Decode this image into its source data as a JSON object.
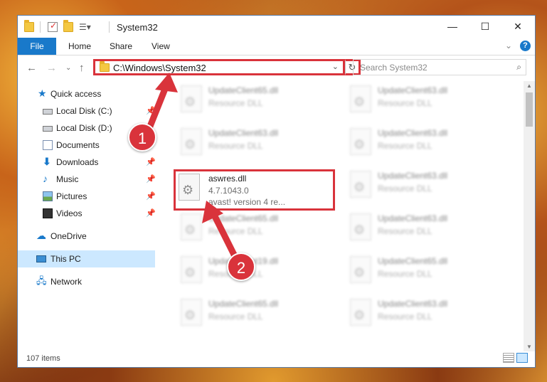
{
  "window": {
    "title": "System32",
    "controls": {
      "minimize": "—",
      "maximize": "☐",
      "close": "✕"
    }
  },
  "ribbon": {
    "tabs": [
      "File",
      "Home",
      "Share",
      "View"
    ],
    "help": "?"
  },
  "navigation": {
    "address": "C:\\Windows\\System32",
    "search_placeholder": "Search System32"
  },
  "sidebar": {
    "items": [
      {
        "label": "Quick access",
        "icon": "star-icon",
        "pinned": false
      },
      {
        "label": "Local Disk (C:)",
        "icon": "drive-icon",
        "pinned": true
      },
      {
        "label": "Local Disk (D:)",
        "icon": "drive-icon",
        "pinned": false
      },
      {
        "label": "Documents",
        "icon": "documents-icon",
        "pinned": true
      },
      {
        "label": "Downloads",
        "icon": "downloads-icon",
        "pinned": true
      },
      {
        "label": "Music",
        "icon": "music-icon",
        "pinned": true
      },
      {
        "label": "Pictures",
        "icon": "pictures-icon",
        "pinned": true
      },
      {
        "label": "Videos",
        "icon": "videos-icon",
        "pinned": true
      },
      {
        "label": "OneDrive",
        "icon": "onedrive-icon",
        "pinned": false
      },
      {
        "label": "This PC",
        "icon": "pc-icon",
        "pinned": false,
        "selected": true
      },
      {
        "label": "Network",
        "icon": "network-icon",
        "pinned": false
      }
    ]
  },
  "files": [
    {
      "name": "UpdateClient65.dll",
      "desc": "Resource DLL",
      "blurred": true
    },
    {
      "name": "UpdateClient63.dll",
      "desc": "Resource DLL",
      "blurred": true
    },
    {
      "name": "UpdateClient63.dll",
      "desc": "Resource DLL",
      "blurred": true
    },
    {
      "name": "UpdateClient63.dll",
      "desc": "Resource DLL",
      "blurred": true
    },
    {
      "name": "aswres.dll",
      "desc": "4.7.1043.0",
      "desc2": "avast! version 4 re...",
      "blurred": false,
      "highlighted": true
    },
    {
      "name": "UpdateClient63.dll",
      "desc": "Resource DLL",
      "blurred": true
    },
    {
      "name": "UpdateClient65.dll",
      "desc": "Resource DLL",
      "blurred": true
    },
    {
      "name": "UpdateClient63.dll",
      "desc": "Resource DLL",
      "blurred": true
    },
    {
      "name": "UpdateClient19.dll",
      "desc": "Resource DLL",
      "blurred": true
    },
    {
      "name": "UpdateClient65.dll",
      "desc": "Resource DLL",
      "blurred": true
    },
    {
      "name": "UpdateClient65.dll",
      "desc": "Resource DLL",
      "blurred": true
    },
    {
      "name": "UpdateClient63.dll",
      "desc": "Resource DLL",
      "blurred": true
    }
  ],
  "status": {
    "item_count": "107 items"
  },
  "annotations": {
    "step1": "1",
    "step2": "2",
    "color": "#d9333b"
  },
  "colors": {
    "accent": "#1979ca",
    "highlight": "#d9333b",
    "selected_bg": "#cce8ff"
  }
}
